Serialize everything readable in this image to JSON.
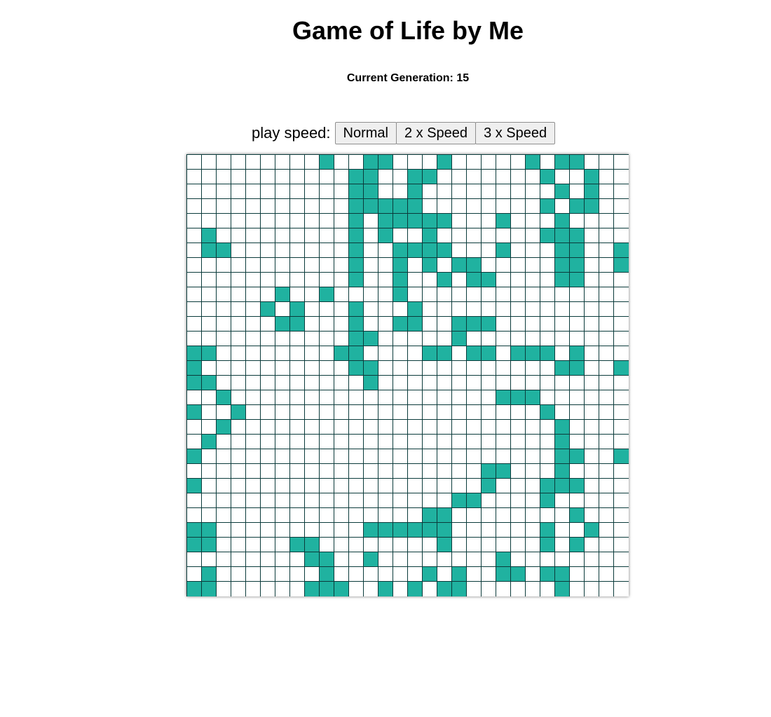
{
  "title": "Game of Life by Me",
  "generation": {
    "label": "Current Generation:",
    "value": "15"
  },
  "speed": {
    "label": "play speed:",
    "buttons": [
      "Normal",
      "2 x Speed",
      "3 x Speed"
    ]
  },
  "colors": {
    "alive": "#20b2a0",
    "dead": "#ffffff",
    "grid_line": "#0b3b3b"
  },
  "board": {
    "rows": 30,
    "cols": 30,
    "cells": [
      "000000000100110001000001011000",
      "000000000001100110000000100100",
      "000000000001100100000000010100",
      "000000000001111100000000101100",
      "000000000001011111000100010000",
      "010000000001010010000000111000",
      "011000000001001111000100011001",
      "000000000001001010110000011001",
      "000000000001001001011000011000",
      "000000100100001000000000000000",
      "000001010001000100000000000000",
      "000000110001001100111000000000",
      "000000000001100000100000000000",
      "110000000011000011011011101000",
      "100000000001100000000000011001",
      "110000000000100000000000000000",
      "001000000000000000000111000000",
      "100100000000000000000000100000",
      "001000000000000000000000010000",
      "010000000000000000000000010000",
      "100000000000000000000000011001",
      "000000000000000000001100010000",
      "100000000000000000001000111000",
      "000000000000000000110000100000",
      "000000000000000011000000001000",
      "110000000000111111000000100100",
      "110000011000000001000000101000",
      "000000001100100000000100000000",
      "010000000100000010100110110000",
      "110000001110010101100000010000"
    ]
  }
}
